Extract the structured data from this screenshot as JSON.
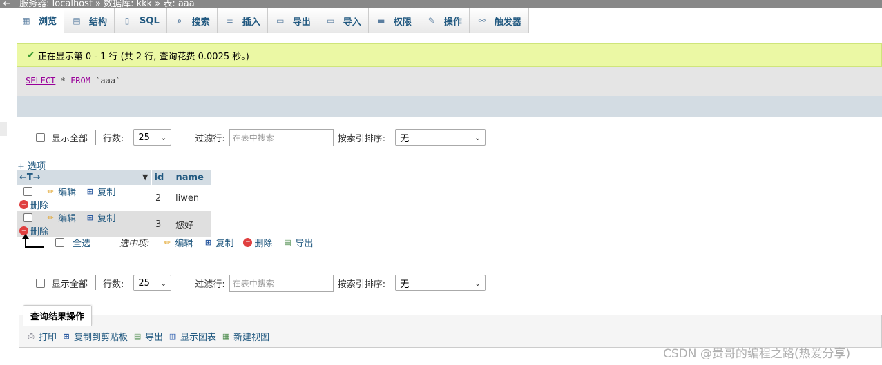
{
  "breadcrumb": {
    "server": "服务器: localhost",
    "database": "数据库: kkk",
    "table": "表: aaa"
  },
  "tabs": [
    {
      "label": "浏览",
      "icon": "table-icon"
    },
    {
      "label": "结构",
      "icon": "structure-icon"
    },
    {
      "label": "SQL",
      "icon": "sql-icon"
    },
    {
      "label": "搜索",
      "icon": "search-icon"
    },
    {
      "label": "插入",
      "icon": "insert-icon"
    },
    {
      "label": "导出",
      "icon": "export-icon"
    },
    {
      "label": "导入",
      "icon": "import-icon"
    },
    {
      "label": "权限",
      "icon": "privileges-icon"
    },
    {
      "label": "操作",
      "icon": "wrench-icon"
    },
    {
      "label": "触发器",
      "icon": "trigger-icon"
    }
  ],
  "message": "正在显示第 0 - 1 行 (共 2 行, 查询花费 0.0025 秒。)",
  "sql": {
    "select": "SELECT",
    "star": "*",
    "from": "FROM",
    "table": "`aaa`"
  },
  "nav": {
    "show_all": "显示全部",
    "rows_label": "行数:",
    "rows_value": "25",
    "filter_label": "过滤行:",
    "filter_placeholder": "在表中搜索",
    "sort_label": "按索引排序:",
    "sort_value": "无"
  },
  "options_link": "+ 选项",
  "table": {
    "arrows": "←T→",
    "columns": [
      "id",
      "name"
    ],
    "row_actions": {
      "edit": "编辑",
      "copy": "复制",
      "delete": "删除"
    },
    "rows": [
      {
        "id": "2",
        "name": "liwen"
      },
      {
        "id": "3",
        "name": "您好"
      }
    ]
  },
  "bulk": {
    "select_all": "全选",
    "with_selected": "选中项:",
    "edit": "编辑",
    "copy": "复制",
    "delete": "删除",
    "export": "导出"
  },
  "query_ops": {
    "title": "查询结果操作",
    "print": "打印",
    "copy_clipboard": "复制到剪贴板",
    "export": "导出",
    "chart": "显示图表",
    "create_view": "新建视图"
  },
  "watermark": "CSDN @贵哥的编程之路(热爱分享)",
  "colors": {
    "link": "#235a81",
    "success_bg": "#ebf8a4",
    "header_bg": "#d3dce3"
  }
}
